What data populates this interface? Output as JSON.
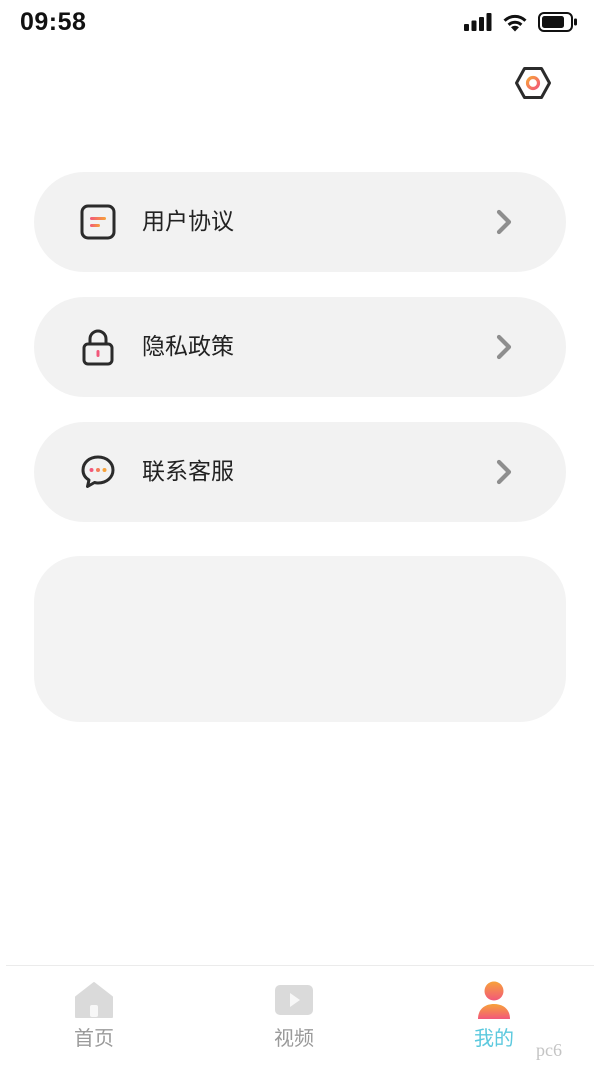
{
  "status_bar": {
    "time": "09:58",
    "icons": [
      "signal-icon",
      "wifi-icon",
      "battery-icon"
    ]
  },
  "header": {
    "settings_icon": "settings-hexagon-icon"
  },
  "menu": {
    "items": [
      {
        "label": "用户协议",
        "icon": "document-icon"
      },
      {
        "label": "隐私政策",
        "icon": "lock-icon"
      },
      {
        "label": "联系客服",
        "icon": "chat-bubble-icon"
      }
    ]
  },
  "tab_bar": {
    "tabs": [
      {
        "label": "首页",
        "icon": "home-icon",
        "active": false
      },
      {
        "label": "视频",
        "icon": "video-play-icon",
        "active": false
      },
      {
        "label": "我的",
        "icon": "profile-icon",
        "active": true
      }
    ]
  },
  "colors": {
    "card_bg": "#f2f2f2",
    "active_tab": "#5cc9de",
    "inactive_tab": "#9a9a9a",
    "accent_orange": "#f7a23a",
    "accent_pink": "#f2587a"
  },
  "watermark": {
    "text": "pc6"
  }
}
